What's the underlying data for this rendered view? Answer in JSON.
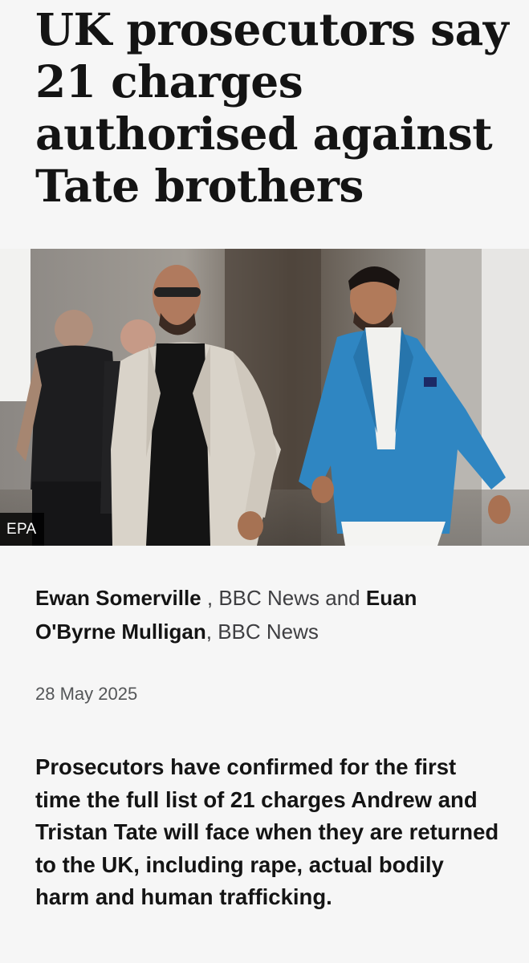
{
  "article": {
    "headline": "UK prosecutors say 21 charges authorised against Tate brothers",
    "image": {
      "credit": "EPA",
      "subject": "photo-two-men-walking-in-corridor"
    },
    "byline": {
      "author1": "Ewan Somerville",
      "sep1": " , ",
      "org1": "BBC News",
      "and": " and ",
      "author2": "Euan O'Byrne Mulligan",
      "sep2": ", ",
      "org2": "BBC News"
    },
    "date": "28 May 2025",
    "summary": "Prosecutors have confirmed for the first time the full list of 21 charges Andrew and Tristan Tate will face when they are returned to the UK, including rape, actual bodily harm and human trafficking."
  },
  "colors": {
    "background": "#f6f6f6",
    "text": "#141414",
    "byline_org": "#3f3f42",
    "date": "#545658",
    "credit_bg": "#000000",
    "blazer_blue": "#2f86c2"
  }
}
